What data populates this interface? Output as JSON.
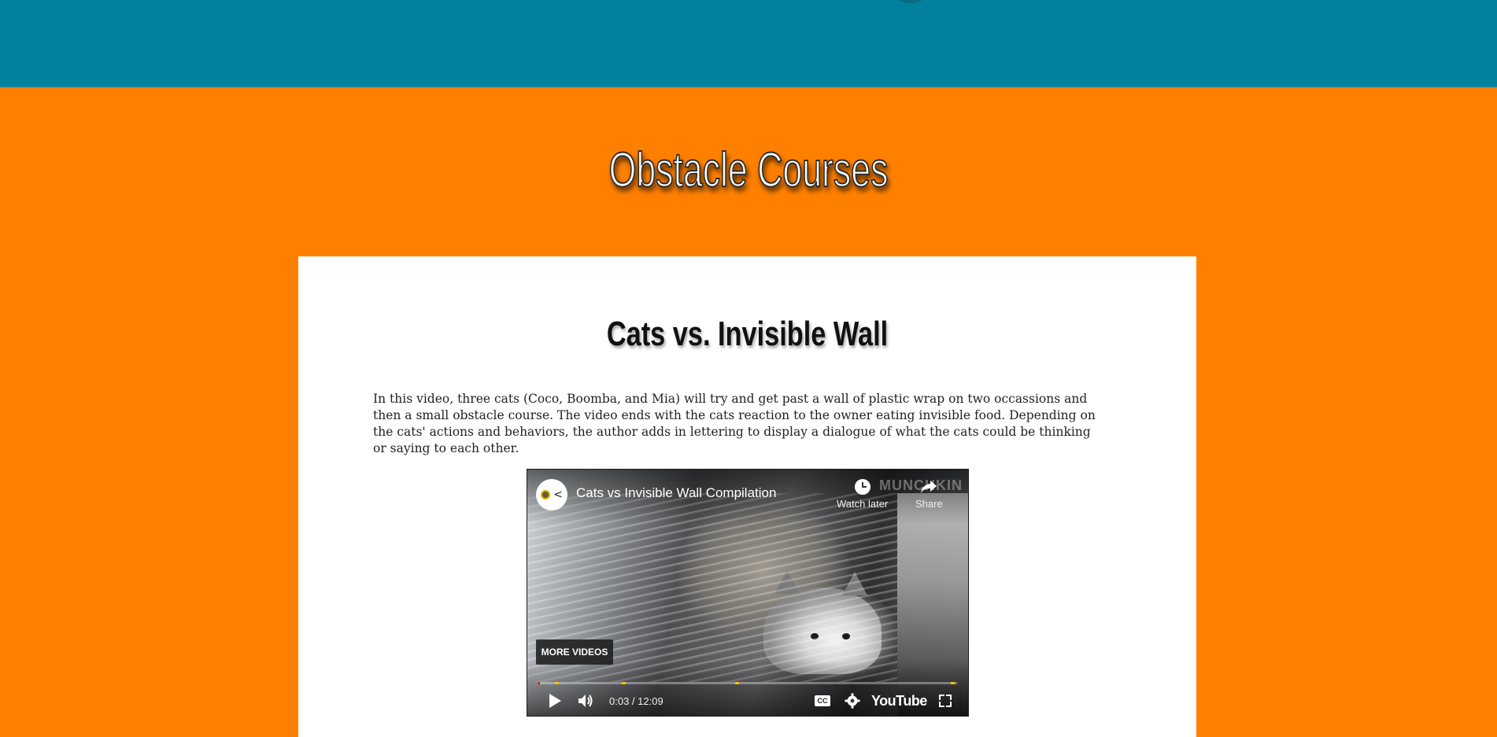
{
  "page": {
    "section_title": "Obstacle Courses"
  },
  "card": {
    "title": "Cats vs. Invisible Wall",
    "description": "In this video, three cats (Coco, Boomba, and Mia) will try and get past a wall of plastic wrap on two occassions and then a small obstacle course. The video ends with the cats reaction to the owner eating invisible food. Depending on the cats' actions and behaviors, the author adds in lettering to display a dialogue of what the cats could be thinking or saying to each other."
  },
  "video": {
    "title": "Cats vs Invisible Wall Compilation",
    "watermark": "MUNCHKIN",
    "watch_later_label": "Watch later",
    "share_label": "Share",
    "more_videos_label": "MORE VIDEOS",
    "time_display": "0:03 / 12:09",
    "progress_fraction": 0.004,
    "chapter_markers": [
      0.04,
      0.2,
      0.47,
      0.985
    ],
    "cc_label": "CC",
    "brand_label": "YouTube",
    "icons": {
      "watch_later": "clock-icon",
      "share": "share-arrow-icon",
      "play": "play-icon",
      "volume": "volume-icon",
      "captions": "captions-icon",
      "settings": "gear-icon",
      "fullscreen": "fullscreen-icon"
    }
  },
  "colors": {
    "header_bg": "#02809d",
    "page_bg": "#ff8000",
    "card_bg": "#ffffff",
    "progress_played": "#ff0000",
    "chapter_marker": "#f2c200"
  }
}
